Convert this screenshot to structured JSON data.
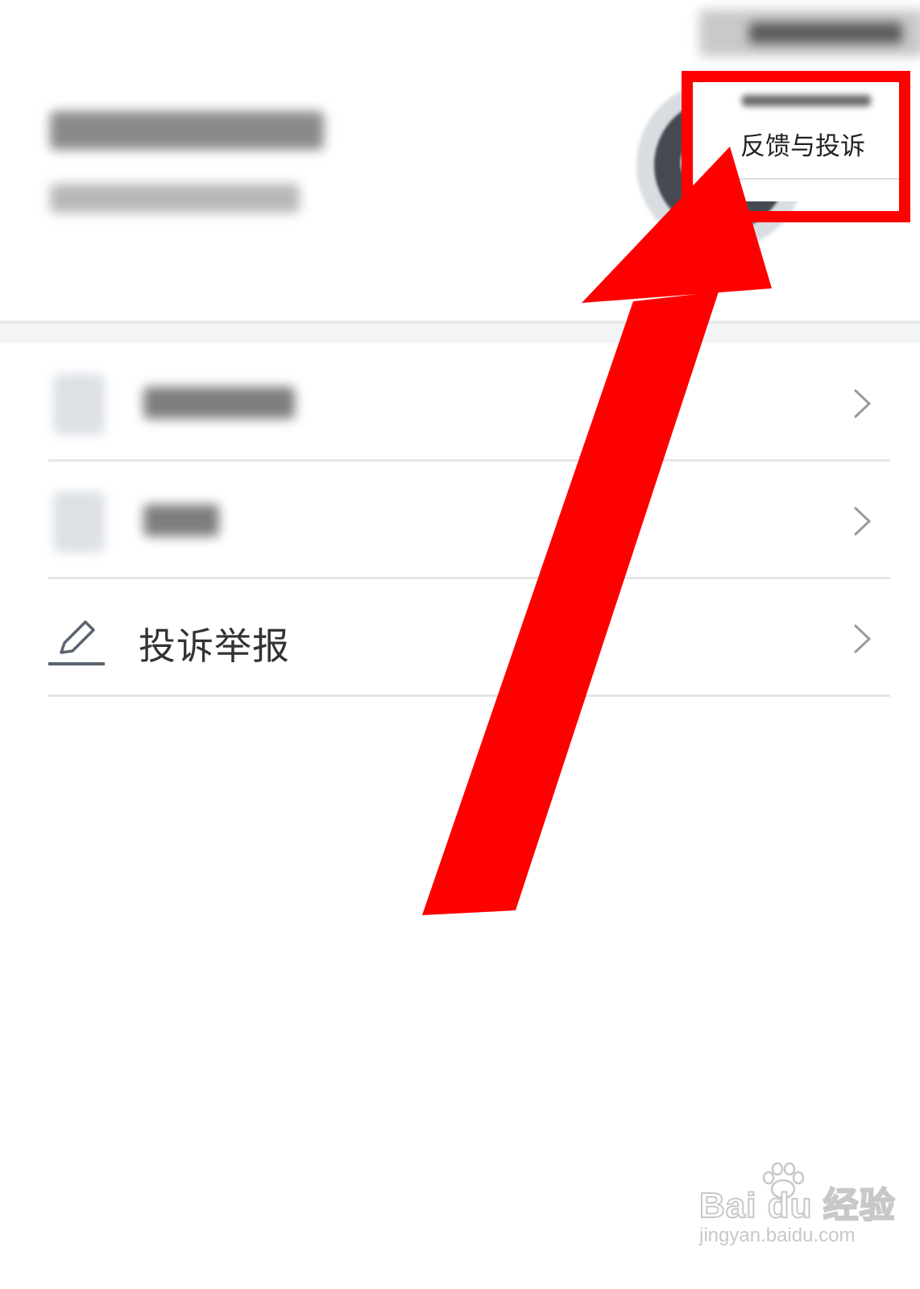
{
  "popup_menu": {
    "feedback_label": "反馈与投诉"
  },
  "menu": {
    "items": [
      {
        "label": "",
        "icon": "blurred-icon",
        "blurred": true
      },
      {
        "label": "",
        "icon": "blurred-icon",
        "blurred": true
      },
      {
        "label": "投诉举报",
        "icon": "pencil-icon",
        "blurred": false
      }
    ]
  },
  "watermark": {
    "brand": "Bai du 经验",
    "url": "jingyan.baidu.com"
  },
  "colors": {
    "highlight": "#ff0000",
    "arrow": "#ff0000",
    "divider": "#e6e6e6",
    "text_primary": "#333333"
  }
}
